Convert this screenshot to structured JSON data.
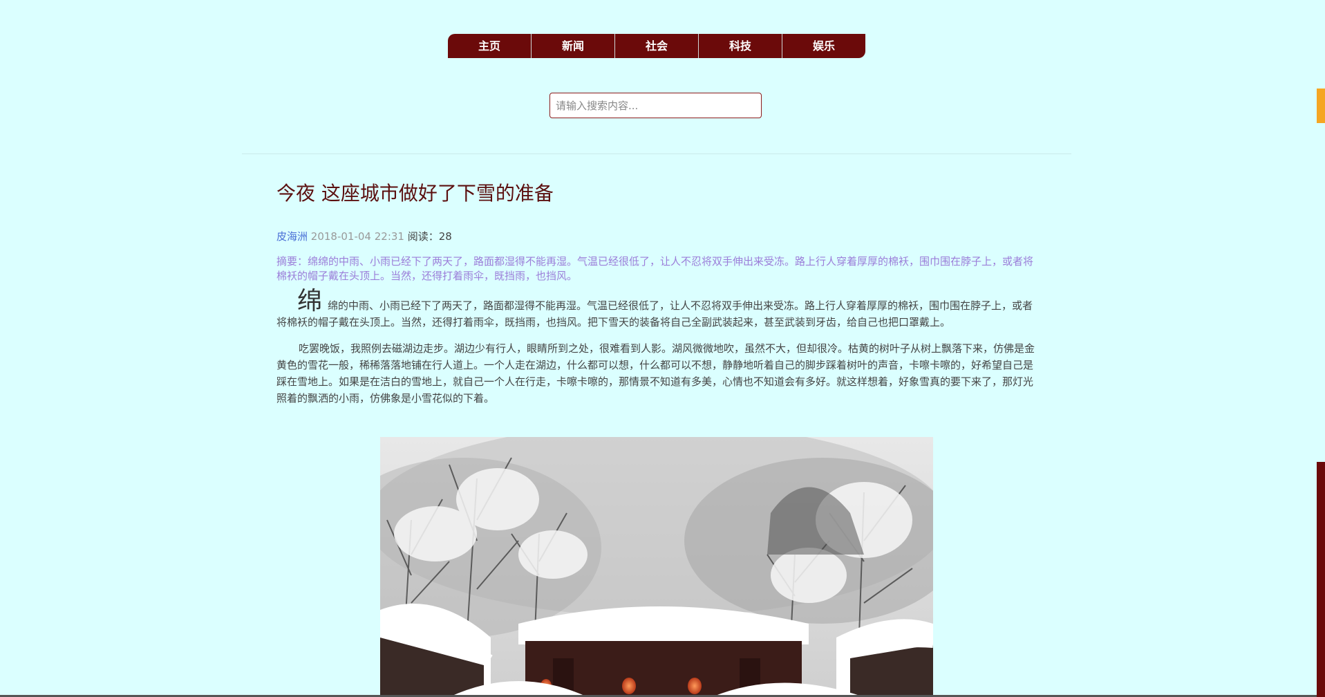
{
  "nav": {
    "items": [
      {
        "label": "主页"
      },
      {
        "label": "新闻"
      },
      {
        "label": "社会"
      },
      {
        "label": "科技"
      },
      {
        "label": "娱乐"
      }
    ]
  },
  "search": {
    "placeholder": "请输入搜索内容..."
  },
  "article": {
    "title": "今夜 这座城市做好了下雪的准备",
    "author": "皮海洲",
    "date": "2018-01-04 22:31",
    "read_label": "阅读：",
    "read_count": "28",
    "summary": "摘要：绵绵的中雨、小雨已经下了两天了，路面都湿得不能再湿。气温已经很低了，让人不忍将双手伸出来受冻。路上行人穿着厚厚的棉袄，围巾围在脖子上，或者将棉袄的帽子戴在头顶上。当然，还得打着雨伞，既挡雨，也挡风。",
    "dropcap": "绵",
    "para1": "绵的中雨、小雨已经下了两天了，路面都湿得不能再湿。气温已经很低了，让人不忍将双手伸出来受冻。路上行人穿着厚厚的棉袄，围巾围在脖子上，或者将棉袄的帽子戴在头顶上。当然，还得打着雨伞，既挡雨，也挡风。把下雪天的装备将自己全副武装起来，甚至武装到牙齿，给自己也把口罩戴上。",
    "para2": "吃罢晚饭，我照例去磁湖边走步。湖边少有行人，眼睛所到之处，很难看到人影。湖风微微地吹，虽然不大，但却很冷。枯黄的树叶子从树上飘落下来，仿佛是金黄色的雪花一般，稀稀落落地铺在行人道上。一个人走在湖边，什么都可以想，什么都可以不想，静静地听着自己的脚步踩着树叶的声音，卡嚓卡嚓的，好希望自己是踩在雪地上。如果是在洁白的雪地上，就自己一个人在行走，卡嚓卡嚓的，那情景不知道有多美，心情也不知道会有多好。就这样想着，好象雪真的要下来了，那灯光照着的飘洒的小雨，仿佛象是小雪花似的下着。"
  },
  "colors": {
    "background": "#dbffff",
    "nav": "#6b0a0a",
    "title": "#5b0f0f",
    "author": "#4a6fd6",
    "summary": "#9b7dd9"
  }
}
